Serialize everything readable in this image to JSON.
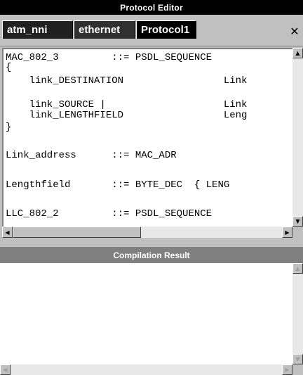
{
  "window_title": "Protocol Editor",
  "tabs": [
    {
      "label": "atm_nni"
    },
    {
      "label": "ethernet"
    },
    {
      "label": "Protocol1"
    }
  ],
  "close_label": "✕",
  "editor": {
    "lines": [
      "MAC_802_3         ::= PSDL_SEQUENCE",
      "{",
      "    link_DESTINATION                 Link",
      "",
      "    link_SOURCE |                    Link",
      "    link_LENGTHFIELD                 Leng",
      "}",
      "",
      "Link_address      ::= MAC_ADR",
      "",
      "Lengthfield       ::= BYTE_DEC  { LENG",
      "",
      "LLC_802_2         ::= PSDL_SEQUENCE"
    ]
  },
  "compilation": {
    "title": "Compilation Result"
  },
  "icons": {
    "arrow_up": "▲",
    "arrow_down": "▼",
    "arrow_left": "◀",
    "arrow_right": "▶"
  }
}
